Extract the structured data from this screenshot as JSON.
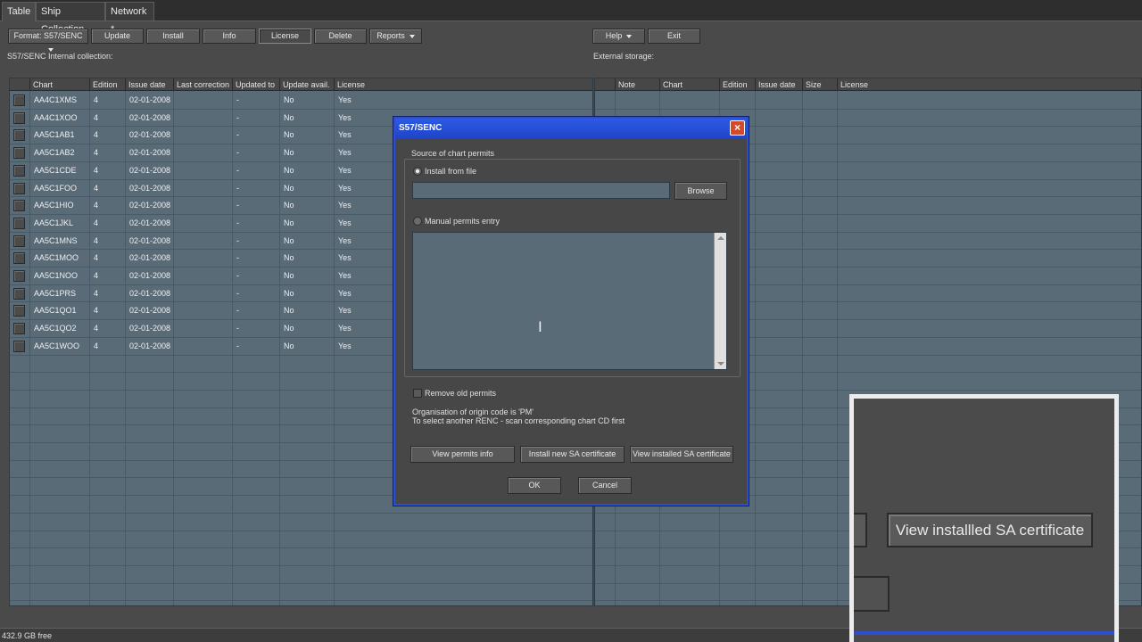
{
  "tabs": [
    {
      "label": "Table",
      "active": true
    },
    {
      "label": "Ship Collection",
      "active": false
    },
    {
      "label": "Network *",
      "active": false
    }
  ],
  "toolbar": {
    "format_label": "Format: S57/SENC",
    "update": "Update",
    "install": "Install",
    "info": "Info",
    "license": "License",
    "delete": "Delete",
    "reports": "Reports",
    "help": "Help",
    "exit": "Exit"
  },
  "internal": {
    "title": "S57/SENC Internal collection:",
    "columns": [
      "Chart",
      "Edition",
      "Issue date",
      "Last correction",
      "Updated to",
      "Update avail.",
      "License"
    ],
    "rows": [
      [
        "AA4C1XMS",
        "4",
        "02-01-2008",
        "",
        "-",
        "No",
        "Yes"
      ],
      [
        "AA4C1XOO",
        "4",
        "02-01-2008",
        "",
        "-",
        "No",
        "Yes"
      ],
      [
        "AA5C1AB1",
        "4",
        "02-01-2008",
        "",
        "-",
        "No",
        "Yes"
      ],
      [
        "AA5C1AB2",
        "4",
        "02-01-2008",
        "",
        "-",
        "No",
        "Yes"
      ],
      [
        "AA5C1CDE",
        "4",
        "02-01-2008",
        "",
        "-",
        "No",
        "Yes"
      ],
      [
        "AA5C1FOO",
        "4",
        "02-01-2008",
        "",
        "-",
        "No",
        "Yes"
      ],
      [
        "AA5C1HIO",
        "4",
        "02-01-2008",
        "",
        "-",
        "No",
        "Yes"
      ],
      [
        "AA5C1JKL",
        "4",
        "02-01-2008",
        "",
        "-",
        "No",
        "Yes"
      ],
      [
        "AA5C1MNS",
        "4",
        "02-01-2008",
        "",
        "-",
        "No",
        "Yes"
      ],
      [
        "AA5C1MOO",
        "4",
        "02-01-2008",
        "",
        "-",
        "No",
        "Yes"
      ],
      [
        "AA5C1NOO",
        "4",
        "02-01-2008",
        "",
        "-",
        "No",
        "Yes"
      ],
      [
        "AA5C1PRS",
        "4",
        "02-01-2008",
        "",
        "-",
        "No",
        "Yes"
      ],
      [
        "AA5C1QO1",
        "4",
        "02-01-2008",
        "",
        "-",
        "No",
        "Yes"
      ],
      [
        "AA5C1QO2",
        "4",
        "02-01-2008",
        "",
        "-",
        "No",
        "Yes"
      ],
      [
        "AA5C1WOO",
        "4",
        "02-01-2008",
        "",
        "-",
        "No",
        "Yes"
      ]
    ]
  },
  "external": {
    "title": "External storage:",
    "columns": [
      "Note",
      "Chart",
      "Edition",
      "Issue date",
      "Size",
      "License"
    ]
  },
  "status": {
    "free": "432.9 GB free"
  },
  "dialog": {
    "title": "S57/SENC",
    "close": "×",
    "group_label": "Source of chart permits",
    "install_from_file": "Install from file",
    "browse": "Browse",
    "manual_entry": "Manual permits entry",
    "remove_old": "Remove old permits",
    "org_line1": "Organisation of origin code is 'PM'",
    "org_line2": "To select another RENC - scan corresponding chart CD first",
    "view_permits": "View permits info",
    "install_sa": "Install new SA certificate",
    "view_sa": "View installed SA certificate",
    "ok": "OK",
    "cancel": "Cancel"
  },
  "zoom": {
    "label": "View installled SA certificate"
  },
  "colors": {
    "grid_bg": "#5a6b78",
    "dialog_title": "#2a4fd0",
    "ui_bg": "#4a4a4a"
  }
}
